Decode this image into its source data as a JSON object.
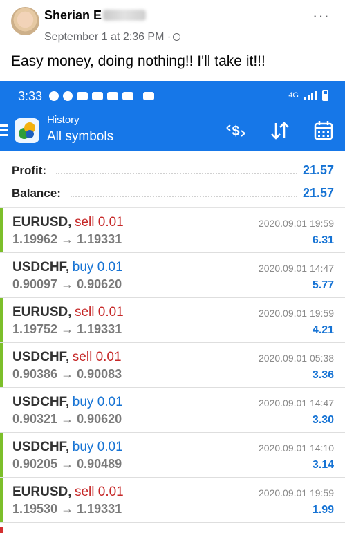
{
  "post": {
    "author": "Sherian E",
    "date": "September 1 at 2:36 PM",
    "separator": "·",
    "more_label": "···",
    "caption": "Easy money, doing nothing!! I'll take it!!!"
  },
  "phone": {
    "status_time": "3:33",
    "network": "4G",
    "accent": "#1677e8",
    "app_title": "History",
    "app_subtitle": "All symbols",
    "toolbar_icons": [
      "currency-exchange-icon",
      "sort-icon",
      "calendar-icon"
    ]
  },
  "summary": {
    "profit_label": "Profit:",
    "profit_value": "21.57",
    "balance_label": "Balance:",
    "balance_value": "21.57"
  },
  "deals": [
    {
      "symbol": "EURUSD,",
      "side": "sell 0.01",
      "prices": "1.19962 → 1.19331",
      "time": "2020.09.01 19:59",
      "profit": "6.31"
    },
    {
      "symbol": "USDCHF,",
      "side": "buy 0.01",
      "prices": "0.90097 → 0.90620",
      "time": "2020.09.01 14:47",
      "profit": "5.77"
    },
    {
      "symbol": "EURUSD,",
      "side": "sell 0.01",
      "prices": "1.19752 → 1.19331",
      "time": "2020.09.01 19:59",
      "profit": "4.21"
    },
    {
      "symbol": "USDCHF,",
      "side": "sell 0.01",
      "prices": "0.90386 → 0.90083",
      "time": "2020.09.01 05:38",
      "profit": "3.36"
    },
    {
      "symbol": "USDCHF,",
      "side": "buy 0.01",
      "prices": "0.90321 → 0.90620",
      "time": "2020.09.01 14:47",
      "profit": "3.30"
    },
    {
      "symbol": "USDCHF,",
      "side": "buy 0.01",
      "prices": "0.90205 → 0.90489",
      "time": "2020.09.01 14:10",
      "profit": "3.14"
    },
    {
      "symbol": "EURUSD,",
      "side": "sell 0.01",
      "prices": "1.19530 → 1.19331",
      "time": "2020.09.01 19:59",
      "profit": "1.99"
    }
  ]
}
